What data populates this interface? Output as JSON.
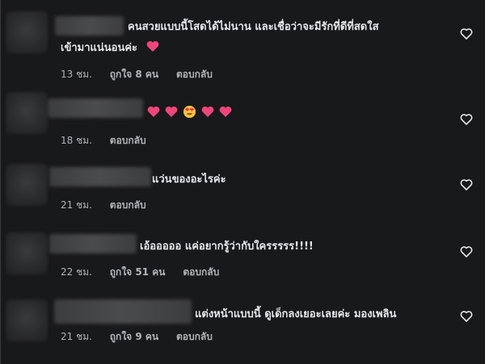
{
  "comments": [
    {
      "text_line1": "คนสวยแบบนี้โสดได้ไม่นาน และเชื่อว่าจะมีรักที่ดีที่สดใส",
      "text_line2": "เข้ามาแน่นอนค่ะ",
      "time": "13 ชม.",
      "like": "ถูกใจ 8 คน",
      "reply": "ตอบกลับ"
    },
    {
      "emoji": [
        "heart",
        "heart",
        "smiling-face-with-heart-eyes",
        "heart",
        "heart"
      ],
      "time": "18 ชม.",
      "reply": "ตอบกลับ"
    },
    {
      "text": "แว่นของอะไรค่ะ",
      "time": "21 ชม.",
      "reply": "ตอบกลับ"
    },
    {
      "text": "เอ้อออออ แค่อยากรู้ว่ากับใครรรรร!!!!",
      "time": "22 ชม.",
      "like": "ถูกใจ 51 คน",
      "reply": "ตอบกลับ"
    },
    {
      "text": "แต่งหน้าแบบนี้ ดูเด็กลงเยอะเลยค่ะ มองเพลิน",
      "time": "21 ชม.",
      "like": "ถูกใจ 9 คน",
      "reply": "ตอบกลับ"
    }
  ],
  "colors": {
    "background": "#18191a",
    "text": "#e4e6eb",
    "meta": "#b0b3b8",
    "heart": "#f0457a"
  },
  "icons": {
    "like": "heart-outline-icon"
  }
}
